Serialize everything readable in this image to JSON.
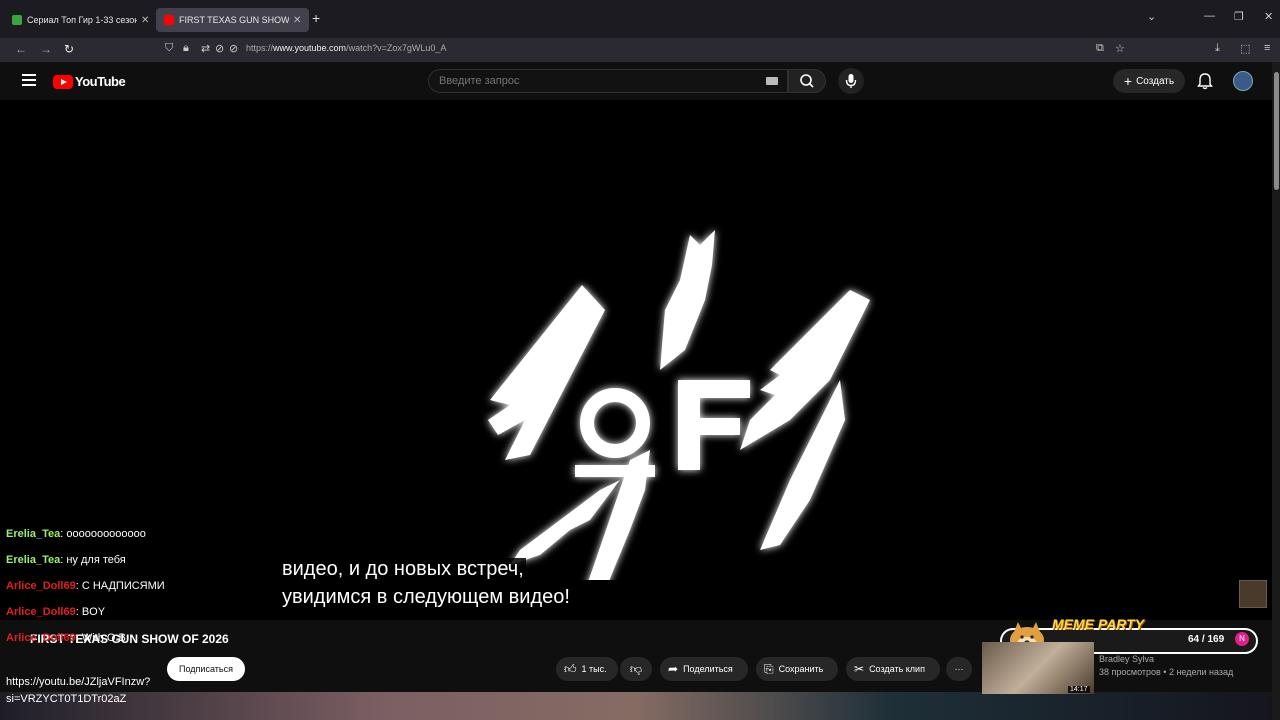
{
  "browser": {
    "tabs": [
      {
        "title": "Сериал Топ Гир 1-33 сезон смотреть",
        "active": false,
        "favicon_color": "#3aa540"
      },
      {
        "title": "FIRST TEXAS GUN SHOW OF 2026",
        "active": true,
        "favicon_color": "#ff0000"
      }
    ],
    "url_prefix": "https://",
    "url_host": "www.youtube.com",
    "url_path": "/watch?v=Zox7gWLu0_A"
  },
  "youtube": {
    "logo_text": "YouTube",
    "search_placeholder": "Введите запрос",
    "create_label": "Создать"
  },
  "player": {
    "subtitle_line1": "видео, и до новых встреч,",
    "subtitle_line2": "увидимся в следующем видео!"
  },
  "chat": [
    {
      "user": "Erelia_Tea",
      "msg": "ооооооооооооо",
      "color": "green"
    },
    {
      "user": "Erelia_Tea",
      "msg": "ну для тебя",
      "color": "green"
    },
    {
      "user": "Arlice_Doll69",
      "msg": "С НАДПИСЯМИ",
      "color": "red"
    },
    {
      "user": "Arlice_Doll69",
      "msg": "BOY",
      "color": "red"
    },
    {
      "user": "Arlice_Doll69",
      "msg": "With O.B",
      "color": "red"
    }
  ],
  "chat_link": {
    "line1": "https://youtu.be/JZljaVFInzw?",
    "line2": "si=VRZYCT0T1DTr02aZ"
  },
  "video_info": {
    "title": "FIRST TEXAS GUN SHOW OF 2026",
    "subscribe_label": "Подписаться",
    "like_count": "1 тыс.",
    "share_label": "Поделиться",
    "save_label": "Сохранить",
    "clip_label": "Создать клип",
    "more_label": "···"
  },
  "meme_party": {
    "title": "MEME PARTY",
    "count": "64 / 169",
    "badge": "N"
  },
  "recommendation": {
    "channel": "Bradley Sylva",
    "meta": "38 просмотров • 2 недели назад",
    "duration": "14:17"
  }
}
